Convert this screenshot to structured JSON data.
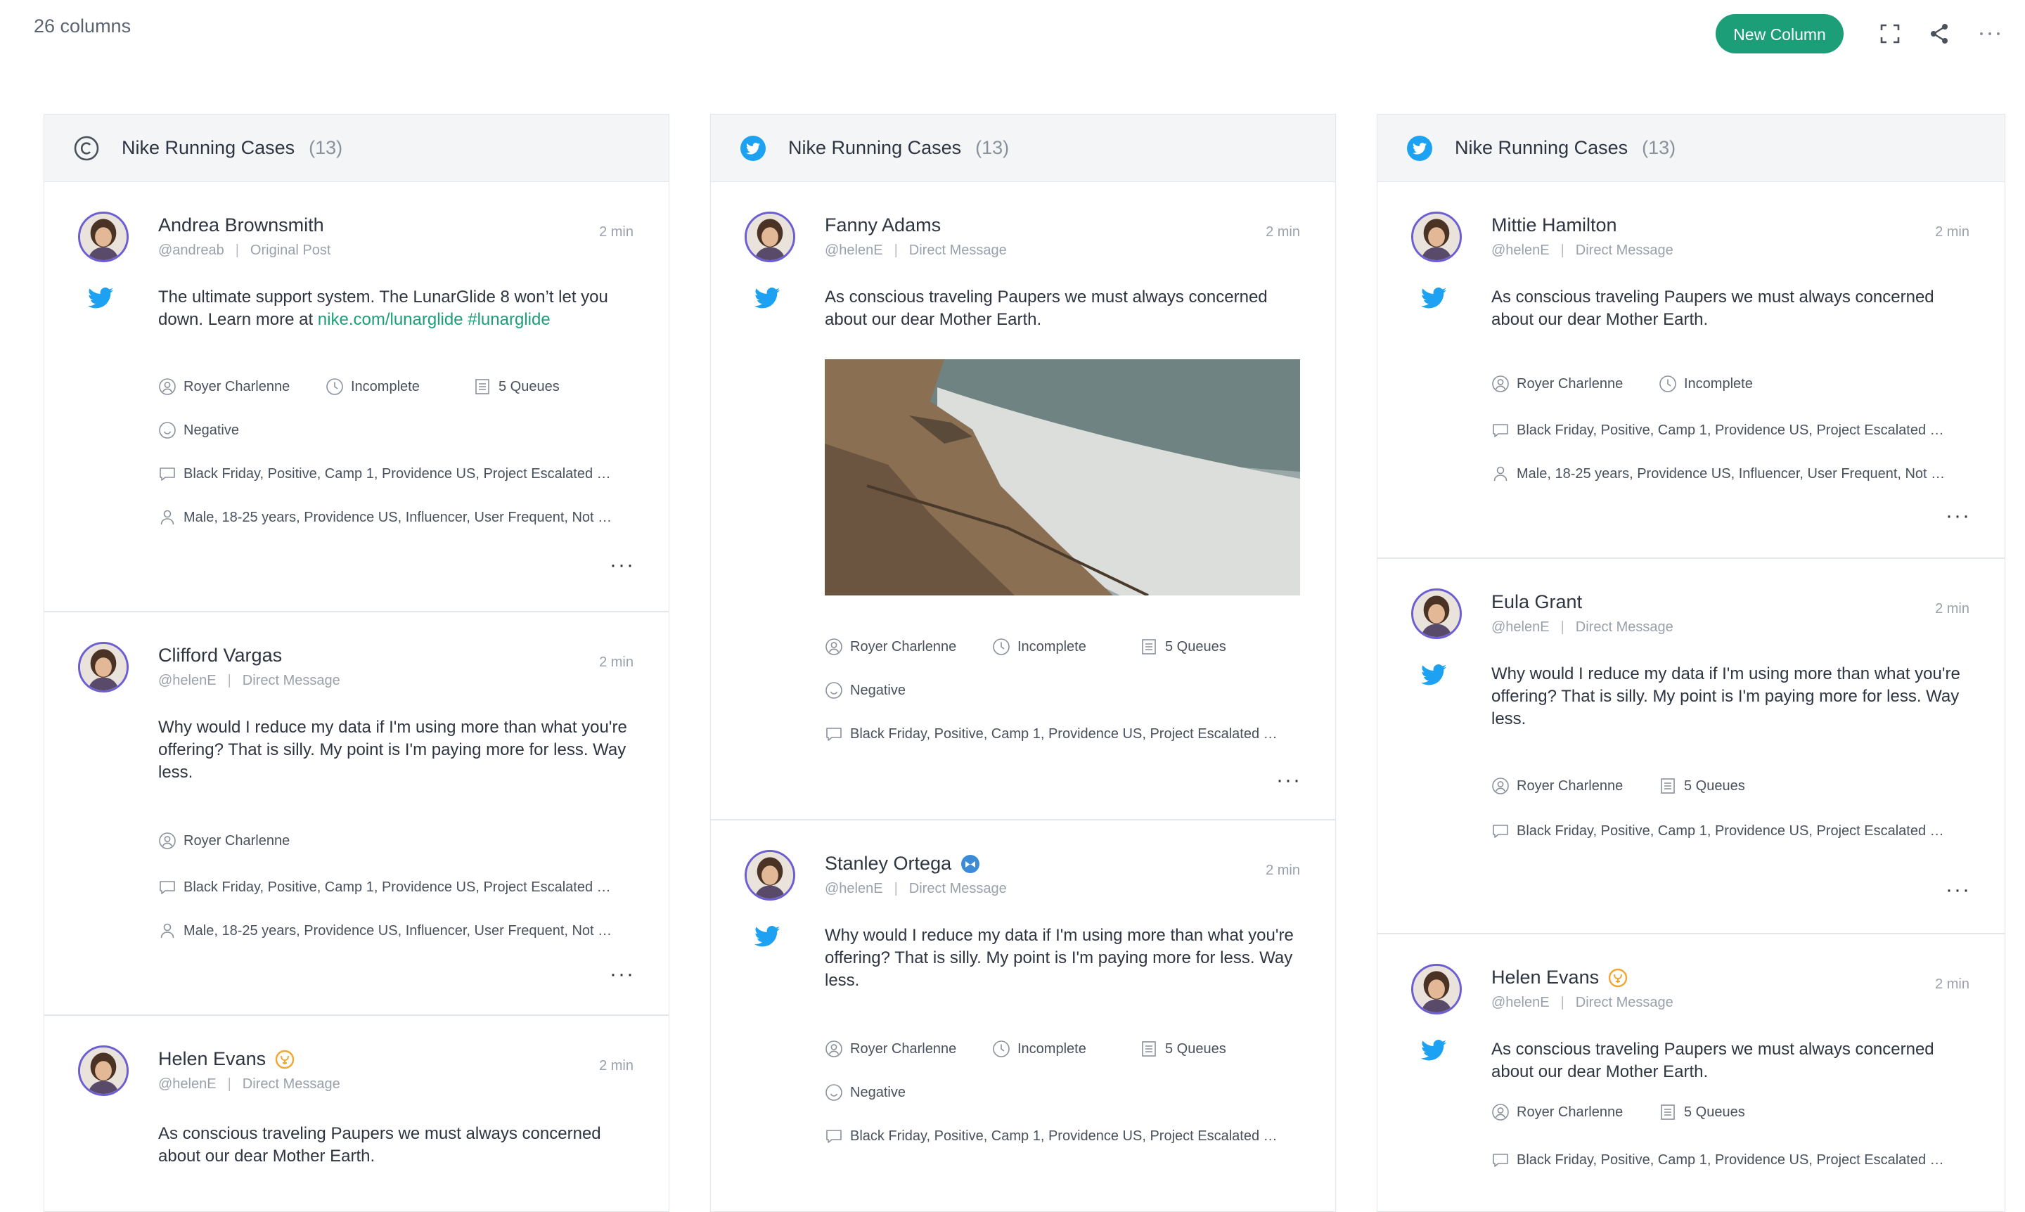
{
  "topbar": {
    "column_count": "26 columns",
    "new_column_label": "New Column",
    "icons": [
      "fullscreen-icon",
      "share-icon",
      "more-icon"
    ]
  },
  "accent": "#1c9e79",
  "columns": [
    {
      "title": "Nike Running Cases",
      "count": "(13)",
      "icon": "copyright-icon",
      "cards": [
        {
          "name": "Andrea Brownsmith",
          "handle": "@andreab",
          "type": "Original Post",
          "time": "2 min",
          "text": "The ultimate support system. The LunarGlide 8 won’t let you down. Learn more at",
          "link": "nike.com/lunarglide #lunarglide",
          "assignee": "Royer Charlenne",
          "status": "Incomplete",
          "queues": "5 Queues",
          "sentiment": "Negative",
          "tags": "Black Friday, Positive, Camp 1, Providence US, Project Escalated n…",
          "demographics": "Male, 18-25 years, Providence US, Influencer, User Frequent, Not …",
          "more": "···"
        },
        {
          "name": "Clifford Vargas",
          "handle": "@helenE",
          "type": "Direct Message",
          "time": "2 min",
          "text": "Why would I reduce my data if I'm using more than what you're offering? That is silly. My point is I'm paying more for less. Way less.",
          "assignee": "Royer Charlenne",
          "tags": "Black Friday, Positive, Camp 1, Providence US, Project Escalated n…",
          "demographics": "Male, 18-25 years, Providence US, Influencer, User Frequent, Not …",
          "more": "···"
        },
        {
          "name": "Helen Evans",
          "handle": "@helenE",
          "type": "Direct Message",
          "time": "2 min",
          "text": "As conscious traveling Paupers we must always concerned about our dear Mother Earth."
        }
      ]
    },
    {
      "title": "Nike Running Cases",
      "count": "(13)",
      "icon": "twitter-icon",
      "cards": [
        {
          "name": "Fanny Adams",
          "handle": "@helenE",
          "type": "Direct Message",
          "time": "2 min",
          "text": "As conscious traveling Paupers we must always concerned about our dear Mother Earth.",
          "assignee": "Royer Charlenne",
          "status": "Incomplete",
          "queues": "5 Queues",
          "sentiment": "Negative",
          "tags": "Black Friday, Positive, Camp 1, Providence US, Project Escalated n…",
          "more": "···"
        },
        {
          "name": "Stanley Ortega",
          "handle": "@helenE",
          "type": "Direct Message",
          "time": "2 min",
          "text": "Why would I reduce my data if I'm using more than what you're offering? That is silly. My point is I'm paying more for less. Way less.",
          "assignee": "Royer Charlenne",
          "status": "Incomplete",
          "queues": "5 Queues",
          "sentiment": "Negative",
          "tags": "Black Friday, Positive, Camp 1, Providence US, Project Escalated n…"
        }
      ]
    },
    {
      "title": "Nike Running Cases",
      "count": "(13)",
      "icon": "twitter-icon",
      "cards": [
        {
          "name": "Mittie Hamilton",
          "handle": "@helenE",
          "type": "Direct Message",
          "time": "2 min",
          "text": "As conscious traveling Paupers we must always concerned about our dear Mother Earth.",
          "assignee": "Royer Charlenne",
          "status": "Incomplete",
          "tags": "Black Friday, Positive, Camp 1, Providence US, Project Escalated n…",
          "demographics": "Male, 18-25 years, Providence US, Influencer, User Frequent, Not …",
          "more": "···"
        },
        {
          "name": "Eula Grant",
          "handle": "@helenE",
          "type": "Direct Message",
          "time": "2 min",
          "text": "Why would I reduce my data if I'm using more than what you're offering? That is silly. My point is I'm paying more for less. Way less.",
          "assignee": "Royer Charlenne",
          "queues": "5 Queues",
          "tags": "Black Friday, Positive, Camp 1, Providence US, Project Escalated n…",
          "more": "···"
        },
        {
          "name": "Helen Evans",
          "handle": "@helenE",
          "type": "Direct Message",
          "time": "2 min",
          "text": "As conscious traveling Paupers we must always concerned about our dear Mother Earth.",
          "assignee": "Royer Charlenne",
          "queues": "5 Queues",
          "tags": "Black Friday, Positive, Camp 1, Providence US, Project Escalated n…"
        }
      ]
    }
  ]
}
